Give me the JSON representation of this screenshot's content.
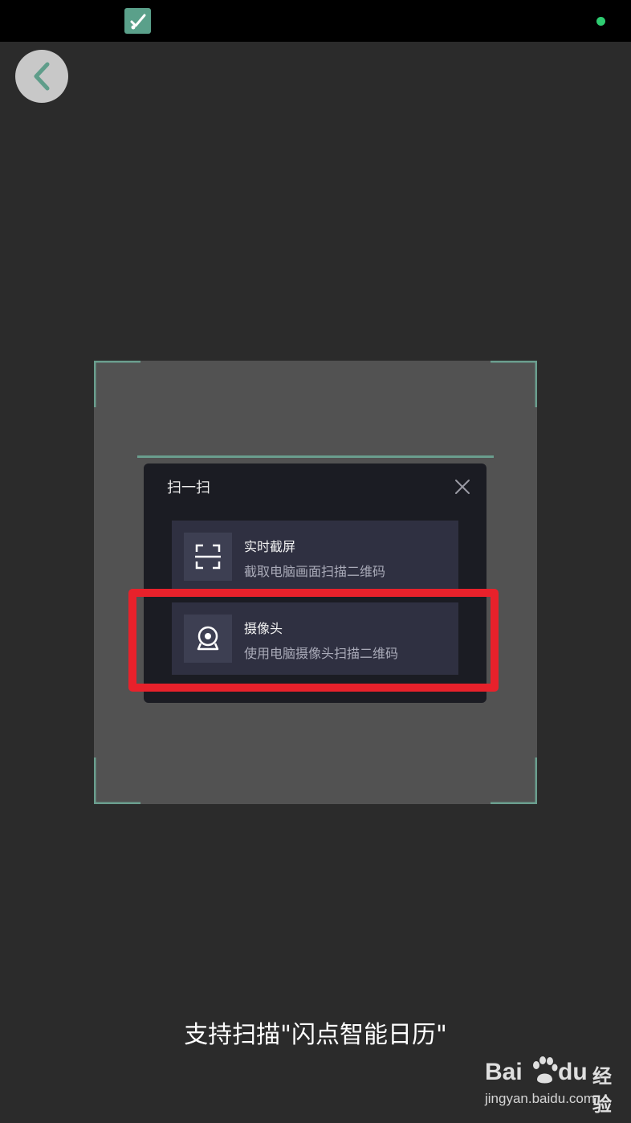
{
  "dialog": {
    "title": "扫一扫",
    "options": [
      {
        "title": "实时截屏",
        "subtitle": "截取电脑画面扫描二维码",
        "icon": "screen-capture-icon"
      },
      {
        "title": "摄像头",
        "subtitle": "使用电脑摄像头扫描二维码",
        "icon": "webcam-icon"
      }
    ]
  },
  "hint_text": "支持扫描\"闪点智能日历\"",
  "watermark": {
    "brand_left": "Bai",
    "brand_right": "du",
    "brand_cn": "经验",
    "url": "jingyan.baidu.com"
  },
  "colors": {
    "background": "#2b2b2b",
    "accent": "#6a9e8e",
    "highlight": "#e8212b",
    "dialog": "#1b1c23",
    "option": "#2f3041",
    "status_dot": "#2ecc71"
  }
}
